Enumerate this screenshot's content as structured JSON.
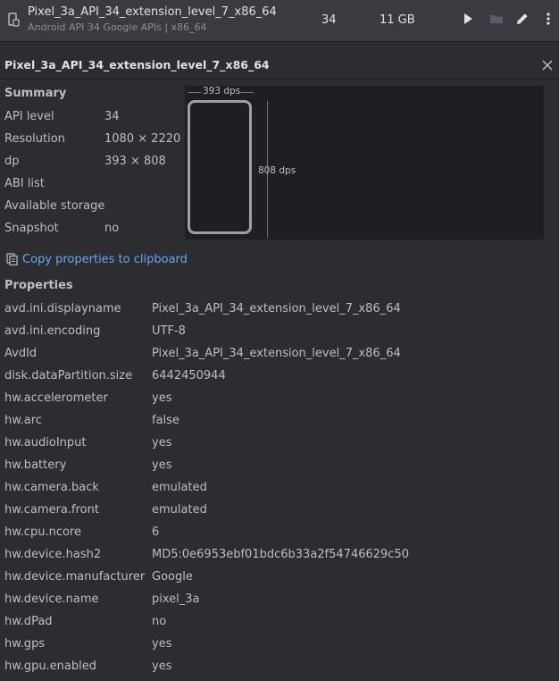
{
  "device": {
    "name": "Pixel_3a_API_34_extension_level_7_x86_64",
    "subtitle": "Android API 34 Google APIs | x86_64",
    "api": "34",
    "size": "11 GB"
  },
  "icons": {
    "device": "phone-icon",
    "run": "play-icon",
    "folder": "folder-icon",
    "edit": "pencil-icon",
    "more": "more-vertical-icon",
    "close": "close-icon",
    "copy": "clipboard-icon"
  },
  "colors": {
    "link": "#6ea4f2",
    "background": "#2b2d30",
    "toolbar": "#393b40",
    "preview": "#1e1f22"
  },
  "panel": {
    "title": "Pixel_3a_API_34_extension_level_7_x86_64"
  },
  "summary": {
    "heading": "Summary",
    "rows": [
      {
        "key": "API level",
        "value": "34"
      },
      {
        "key": "Resolution",
        "value": "1080 × 2220"
      },
      {
        "key": "dp",
        "value": "393 × 808"
      },
      {
        "key": "ABI list",
        "value": ""
      },
      {
        "key": "Available storage",
        "value": ""
      },
      {
        "key": "Snapshot",
        "value": "no"
      }
    ]
  },
  "preview": {
    "width_label": "393 dps",
    "height_label": "808 dps"
  },
  "copy_link": "Copy properties to clipboard",
  "properties": {
    "heading": "Properties",
    "rows": [
      {
        "key": "avd.ini.displayname",
        "value": "Pixel_3a_API_34_extension_level_7_x86_64"
      },
      {
        "key": "avd.ini.encoding",
        "value": "UTF-8"
      },
      {
        "key": "AvdId",
        "value": "Pixel_3a_API_34_extension_level_7_x86_64"
      },
      {
        "key": "disk.dataPartition.size",
        "value": "6442450944"
      },
      {
        "key": "hw.accelerometer",
        "value": "yes"
      },
      {
        "key": "hw.arc",
        "value": "false"
      },
      {
        "key": "hw.audioInput",
        "value": "yes"
      },
      {
        "key": "hw.battery",
        "value": "yes"
      },
      {
        "key": "hw.camera.back",
        "value": "emulated"
      },
      {
        "key": "hw.camera.front",
        "value": "emulated"
      },
      {
        "key": "hw.cpu.ncore",
        "value": "6"
      },
      {
        "key": "hw.device.hash2",
        "value": "MD5:0e6953ebf01bdc6b33a2f54746629c50"
      },
      {
        "key": "hw.device.manufacturer",
        "value": "Google"
      },
      {
        "key": "hw.device.name",
        "value": "pixel_3a"
      },
      {
        "key": "hw.dPad",
        "value": "no"
      },
      {
        "key": "hw.gps",
        "value": "yes"
      },
      {
        "key": "hw.gpu.enabled",
        "value": "yes"
      }
    ]
  }
}
